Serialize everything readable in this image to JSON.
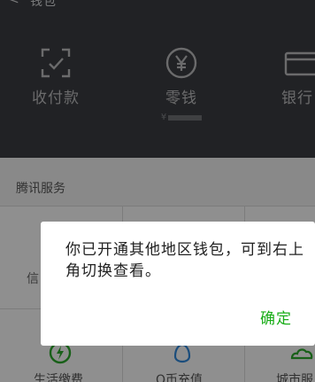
{
  "header": {
    "back_glyph": "<",
    "title": "钱包"
  },
  "wallet": {
    "items": [
      {
        "label": "收付款",
        "icon": "scan-pay-icon"
      },
      {
        "label": "零钱",
        "icon": "yen-coin-icon"
      },
      {
        "label": "银行",
        "icon": "bank-card-icon"
      }
    ],
    "balance_prefix": "¥"
  },
  "services": {
    "title": "腾讯服务",
    "partial_item_label": "信",
    "bottom_items": [
      {
        "label": "生活缴费",
        "icon": "lightning-icon"
      },
      {
        "label": "Q币充值",
        "icon": "q-penguin-icon"
      },
      {
        "label": "城市服",
        "icon": "city-cloud-icon"
      }
    ]
  },
  "dialog": {
    "message": "你已开通其他地区钱包，可到右上角切换查看。",
    "confirm_label": "确定"
  },
  "colors": {
    "wallet_bg": "#3a3c40",
    "accent_green": "#1aad19",
    "overlay": "rgba(0,0,0,0.42)"
  }
}
